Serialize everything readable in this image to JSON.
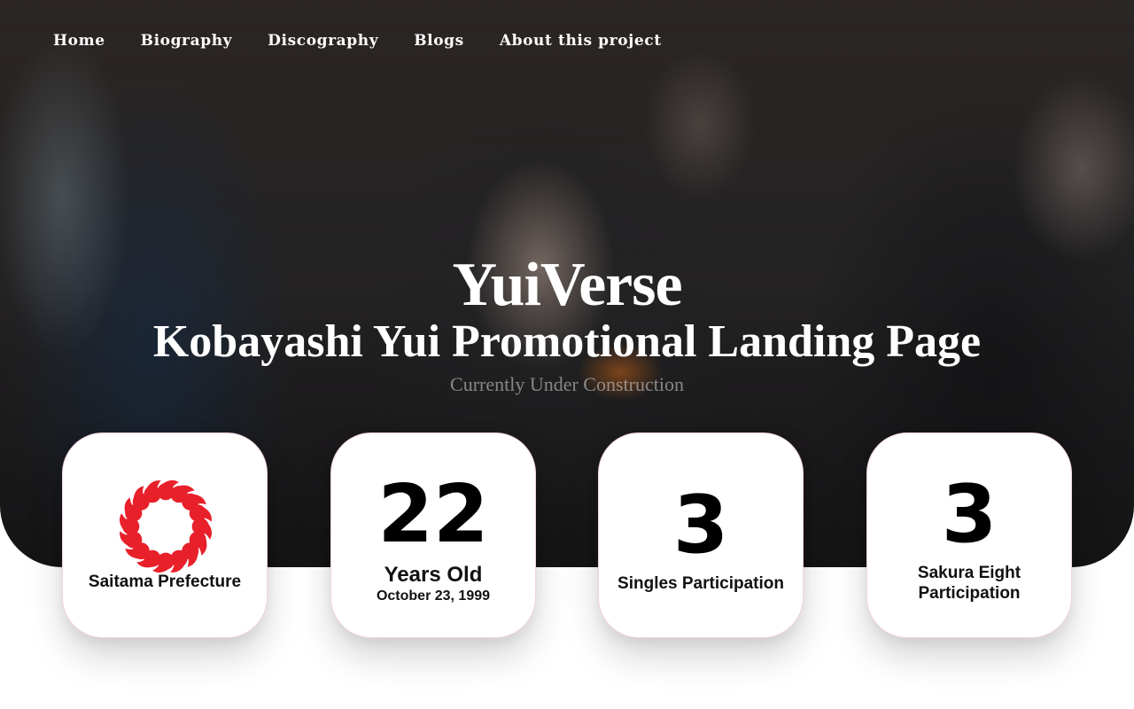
{
  "nav": {
    "items": [
      {
        "label": "Home"
      },
      {
        "label": "Biography"
      },
      {
        "label": "Discography"
      },
      {
        "label": "Blogs"
      },
      {
        "label": "About this project"
      }
    ]
  },
  "hero": {
    "title": "YuiVerse",
    "subtitle": "Kobayashi Yui Promotional Landing Page",
    "status": "Currently Under Construction"
  },
  "stats": {
    "prefecture": {
      "icon": "saitama-prefecture-emblem-icon",
      "label": "Saitama Prefecture"
    },
    "age": {
      "value": "22",
      "label": "Years Old",
      "birthday": "October 23, 1999"
    },
    "singles": {
      "value": "3",
      "label": "Singles Participation"
    },
    "sakura_eight": {
      "value": "3",
      "label": "Sakura Eight Participation"
    }
  },
  "colors": {
    "emblem_red": "#e8202a",
    "card_border": "#f2d3e0",
    "text_white": "#ffffff"
  }
}
